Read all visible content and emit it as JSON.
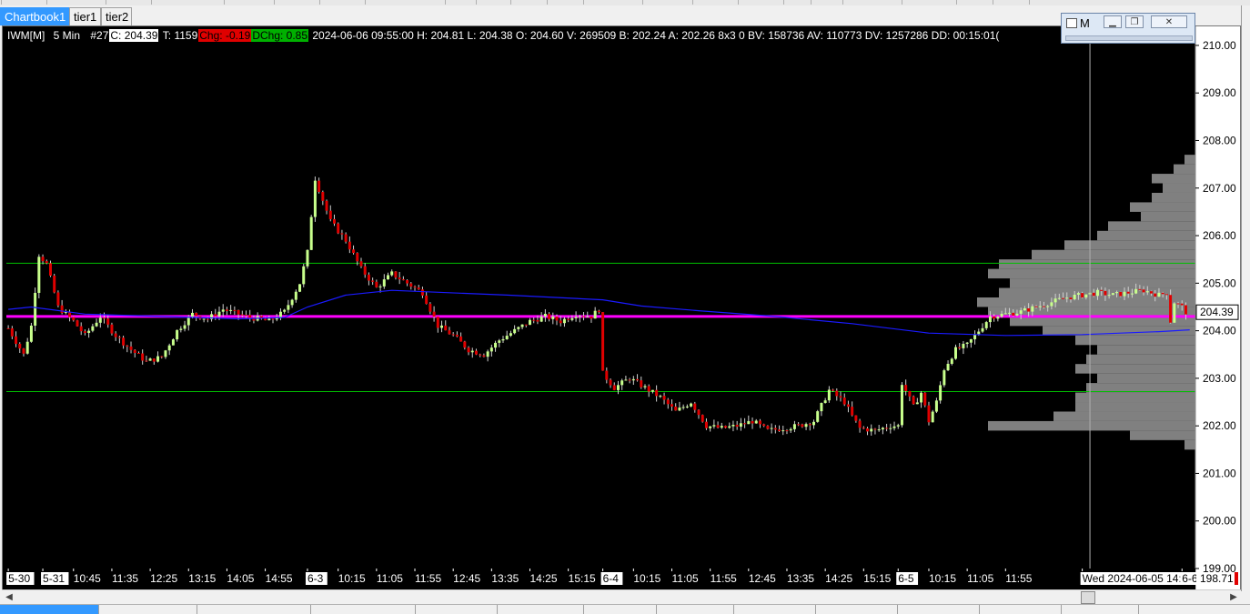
{
  "tabs": [
    {
      "label": "Chartbook1",
      "active": true
    },
    {
      "label": "tier1",
      "active": false
    },
    {
      "label": "tier2",
      "active": false
    }
  ],
  "mini_window": {
    "title": "M",
    "buttons": [
      "minimize",
      "restore",
      "close"
    ]
  },
  "infobar": {
    "symbol": "IWM[M]",
    "interval": "5 Min",
    "bar_index": "#27",
    "close": "C: 204.39",
    "trades": "T: 1159",
    "chg": "Chg: -0.19",
    "dchg": "DChg: 0.85",
    "details": "2024-06-06 09:55:00 H: 204.81 L: 204.38 O: 204.60 V: 269509 B: 202.24 A: 202.26 8x3 0 BV: 158736 AV: 110773 DV: 1257286 DD: 00:15:01("
  },
  "colors": {
    "background": "#000000",
    "bull": "#c8ff8c",
    "bear": "#e00000",
    "wick": "#d0d0d0",
    "vwap": "#1a1aff",
    "poc_line": "#ff00ff",
    "level_line": "#00c000",
    "profile": "#808080",
    "crosshair": "#b0b0b0",
    "axis_text": "#ffffff"
  },
  "chart_data": {
    "type": "candlestick",
    "symbol": "IWM",
    "ylim": [
      199.0,
      210.4
    ],
    "y_ticks": [
      "210.00",
      "209.00",
      "208.00",
      "207.00",
      "206.00",
      "205.00",
      "204.00",
      "203.00",
      "202.00",
      "201.00",
      "200.00",
      "199.00"
    ],
    "current_price": "204.39",
    "scroll_price": "198.71",
    "time_labels": [
      {
        "text": "5-30",
        "i": 0,
        "boxed": true
      },
      {
        "text": "5-31",
        "i": 9,
        "boxed": true
      },
      {
        "text": "10:45",
        "i": 17
      },
      {
        "text": "11:35",
        "i": 27
      },
      {
        "text": "12:25",
        "i": 37
      },
      {
        "text": "13:15",
        "i": 47
      },
      {
        "text": "14:05",
        "i": 57
      },
      {
        "text": "14:55",
        "i": 67
      },
      {
        "text": "6-3",
        "i": 78,
        "boxed": true
      },
      {
        "text": "10:15",
        "i": 86
      },
      {
        "text": "11:05",
        "i": 96
      },
      {
        "text": "11:55",
        "i": 106
      },
      {
        "text": "12:45",
        "i": 116
      },
      {
        "text": "13:35",
        "i": 126
      },
      {
        "text": "14:25",
        "i": 136
      },
      {
        "text": "15:15",
        "i": 146
      },
      {
        "text": "6-4",
        "i": 155,
        "boxed": true
      },
      {
        "text": "10:15",
        "i": 163
      },
      {
        "text": "11:05",
        "i": 173
      },
      {
        "text": "11:55",
        "i": 183
      },
      {
        "text": "12:45",
        "i": 193
      },
      {
        "text": "13:35",
        "i": 203
      },
      {
        "text": "14:25",
        "i": 213
      },
      {
        "text": "15:15",
        "i": 223
      },
      {
        "text": "6-5",
        "i": 232,
        "boxed": true
      },
      {
        "text": "10:15",
        "i": 240
      },
      {
        "text": "11:05",
        "i": 250
      },
      {
        "text": "11:55",
        "i": 260
      },
      {
        "text": "Wed 2024-06-05  14:00:00",
        "i": 280,
        "boxed": true
      },
      {
        "text": "6-6",
        "i": 306,
        "boxed": true
      }
    ],
    "horizontal_levels": [
      {
        "name": "upper-level",
        "price": 205.42,
        "color": "#00c000"
      },
      {
        "name": "lower-level",
        "price": 202.72,
        "color": "#00c000"
      },
      {
        "name": "poc-line",
        "price": 204.3,
        "color": "#ff00ff"
      }
    ],
    "crosshair_bar": 282,
    "close_anchors": [
      [
        0,
        204.05
      ],
      [
        4,
        203.5
      ],
      [
        6,
        204.1
      ],
      [
        8,
        205.6
      ],
      [
        10,
        205.4
      ],
      [
        13,
        204.5
      ],
      [
        17,
        204.2
      ],
      [
        20,
        203.9
      ],
      [
        24,
        204.3
      ],
      [
        28,
        203.9
      ],
      [
        32,
        203.6
      ],
      [
        36,
        203.35
      ],
      [
        40,
        203.45
      ],
      [
        44,
        204.0
      ],
      [
        48,
        204.35
      ],
      [
        52,
        204.25
      ],
      [
        56,
        204.45
      ],
      [
        62,
        204.3
      ],
      [
        68,
        204.2
      ],
      [
        72,
        204.4
      ],
      [
        76,
        205.0
      ],
      [
        78,
        205.65
      ],
      [
        80,
        207.2
      ],
      [
        84,
        206.3
      ],
      [
        88,
        205.9
      ],
      [
        92,
        205.3
      ],
      [
        96,
        204.9
      ],
      [
        100,
        205.2
      ],
      [
        104,
        205.0
      ],
      [
        108,
        204.8
      ],
      [
        112,
        204.1
      ],
      [
        116,
        203.9
      ],
      [
        120,
        203.6
      ],
      [
        124,
        203.5
      ],
      [
        128,
        203.8
      ],
      [
        132,
        204.0
      ],
      [
        136,
        204.2
      ],
      [
        140,
        204.3
      ],
      [
        144,
        204.2
      ],
      [
        148,
        204.35
      ],
      [
        152,
        204.3
      ],
      [
        154,
        204.45
      ],
      [
        155,
        203.1
      ],
      [
        158,
        202.8
      ],
      [
        162,
        203.0
      ],
      [
        166,
        202.8
      ],
      [
        170,
        202.6
      ],
      [
        174,
        202.3
      ],
      [
        178,
        202.5
      ],
      [
        182,
        202.0
      ],
      [
        186,
        201.95
      ],
      [
        190,
        202.0
      ],
      [
        194,
        202.1
      ],
      [
        198,
        201.9
      ],
      [
        202,
        201.95
      ],
      [
        206,
        202.0
      ],
      [
        210,
        202.1
      ],
      [
        214,
        202.75
      ],
      [
        218,
        202.5
      ],
      [
        220,
        202.2
      ],
      [
        222,
        201.95
      ],
      [
        226,
        201.9
      ],
      [
        230,
        202.0
      ],
      [
        232,
        202.0
      ],
      [
        233,
        202.9
      ],
      [
        236,
        202.4
      ],
      [
        238,
        202.7
      ],
      [
        240,
        202.1
      ],
      [
        242,
        202.5
      ],
      [
        244,
        203.2
      ],
      [
        247,
        203.6
      ],
      [
        250,
        203.7
      ],
      [
        253,
        204.0
      ],
      [
        256,
        204.3
      ],
      [
        260,
        204.35
      ],
      [
        264,
        204.4
      ],
      [
        268,
        204.5
      ],
      [
        272,
        204.6
      ],
      [
        276,
        204.7
      ],
      [
        280,
        204.75
      ],
      [
        284,
        204.8
      ],
      [
        288,
        204.75
      ],
      [
        292,
        204.8
      ],
      [
        296,
        204.85
      ],
      [
        300,
        204.75
      ],
      [
        302,
        204.8
      ],
      [
        303,
        204.2
      ],
      [
        304,
        204.6
      ],
      [
        306,
        204.5
      ],
      [
        307,
        204.39
      ]
    ],
    "vwap": [
      [
        0,
        204.45
      ],
      [
        6,
        204.5
      ],
      [
        20,
        204.35
      ],
      [
        40,
        204.3
      ],
      [
        60,
        204.25
      ],
      [
        72,
        204.28
      ],
      [
        78,
        204.5
      ],
      [
        88,
        204.75
      ],
      [
        100,
        204.85
      ],
      [
        130,
        204.75
      ],
      [
        155,
        204.65
      ],
      [
        165,
        204.52
      ],
      [
        180,
        204.42
      ],
      [
        200,
        204.3
      ],
      [
        220,
        204.15
      ],
      [
        240,
        203.95
      ],
      [
        260,
        203.9
      ],
      [
        280,
        203.92
      ],
      [
        300,
        203.98
      ],
      [
        308,
        204.02
      ]
    ],
    "profile": [
      [
        207.6,
        0.05
      ],
      [
        207.4,
        0.1
      ],
      [
        207.2,
        0.2
      ],
      [
        207.0,
        0.15
      ],
      [
        206.8,
        0.2
      ],
      [
        206.6,
        0.3
      ],
      [
        206.4,
        0.25
      ],
      [
        206.2,
        0.4
      ],
      [
        206.0,
        0.45
      ],
      [
        205.8,
        0.6
      ],
      [
        205.6,
        0.75
      ],
      [
        205.4,
        0.9
      ],
      [
        205.2,
        0.95
      ],
      [
        205.0,
        0.85
      ],
      [
        204.8,
        0.9
      ],
      [
        204.6,
        1.0
      ],
      [
        204.4,
        0.95
      ],
      [
        204.2,
        0.85
      ],
      [
        204.0,
        0.7
      ],
      [
        203.8,
        0.55
      ],
      [
        203.6,
        0.45
      ],
      [
        203.4,
        0.5
      ],
      [
        203.2,
        0.55
      ],
      [
        203.0,
        0.45
      ],
      [
        202.8,
        0.5
      ],
      [
        202.6,
        0.55
      ],
      [
        202.4,
        0.55
      ],
      [
        202.2,
        0.65
      ],
      [
        202.0,
        0.95
      ],
      [
        201.8,
        0.3
      ],
      [
        201.6,
        0.05
      ]
    ]
  }
}
